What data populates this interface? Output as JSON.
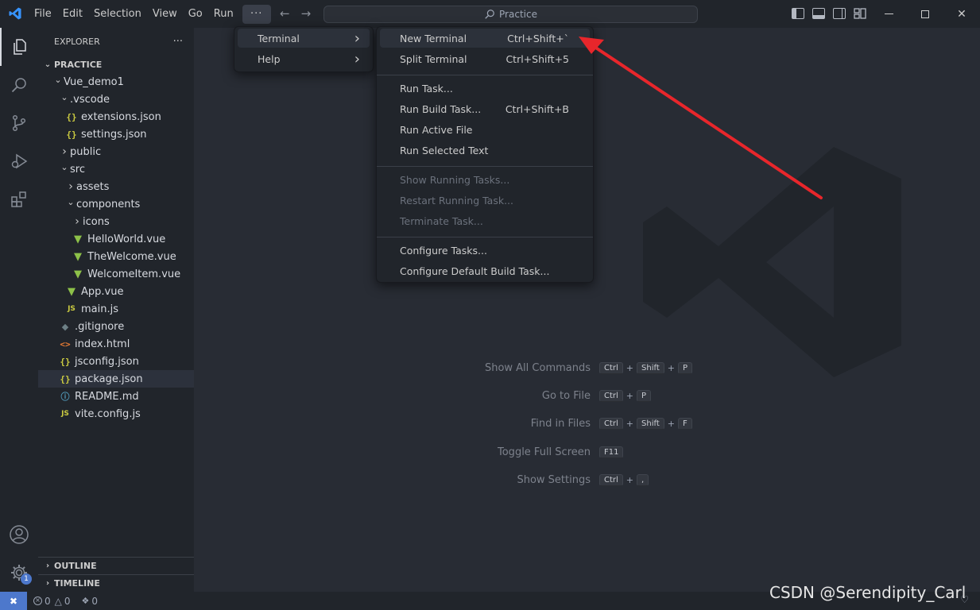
{
  "titlebar": {
    "menus": [
      "File",
      "Edit",
      "Selection",
      "View",
      "Go",
      "Run"
    ],
    "more_label": "···",
    "command_center": "Practice",
    "nav_back_icon": "arrow-left-icon",
    "nav_forward_icon": "arrow-right-icon",
    "layout_icons": [
      "toggle-primary-sidebar-icon",
      "toggle-panel-icon",
      "toggle-secondary-sidebar-icon",
      "customize-layout-icon"
    ],
    "window_controls": [
      "minimize-icon",
      "maximize-icon",
      "close-icon"
    ]
  },
  "activitybar": {
    "items": [
      "explorer-icon",
      "search-icon",
      "source-control-icon",
      "run-debug-icon",
      "extensions-icon"
    ],
    "bottom": [
      "accounts-icon",
      "manage-gear-icon"
    ],
    "manage_badge": "1"
  },
  "sidebar": {
    "title": "EXPLORER",
    "more": "···",
    "section": "PRACTICE",
    "tree": [
      {
        "label": "Vue_demo1",
        "type": "folder-open"
      },
      {
        "label": ".vscode",
        "type": "folder-open"
      },
      {
        "label": "extensions.json",
        "type": "json"
      },
      {
        "label": "settings.json",
        "type": "json"
      },
      {
        "label": "public",
        "type": "folder-closed"
      },
      {
        "label": "src",
        "type": "folder-open"
      },
      {
        "label": "assets",
        "type": "folder-closed"
      },
      {
        "label": "components",
        "type": "folder-open"
      },
      {
        "label": "icons",
        "type": "folder-closed"
      },
      {
        "label": "HelloWorld.vue",
        "type": "vue"
      },
      {
        "label": "TheWelcome.vue",
        "type": "vue"
      },
      {
        "label": "WelcomeItem.vue",
        "type": "vue"
      },
      {
        "label": "App.vue",
        "type": "vue"
      },
      {
        "label": "main.js",
        "type": "js"
      },
      {
        "label": ".gitignore",
        "type": "git"
      },
      {
        "label": "index.html",
        "type": "html"
      },
      {
        "label": "jsconfig.json",
        "type": "json"
      },
      {
        "label": "package.json",
        "type": "json",
        "selected": true
      },
      {
        "label": "README.md",
        "type": "info"
      },
      {
        "label": "vite.config.js",
        "type": "js"
      }
    ],
    "outline": "OUTLINE",
    "timeline": "TIMELINE"
  },
  "menu_level1": {
    "items": [
      {
        "label": "Terminal",
        "highlighted": true
      },
      {
        "label": "Help"
      }
    ]
  },
  "terminal_menu": {
    "groups": [
      [
        {
          "label": "New Terminal",
          "shortcut": "Ctrl+Shift+`",
          "highlighted": true
        },
        {
          "label": "Split Terminal",
          "shortcut": "Ctrl+Shift+5"
        }
      ],
      [
        {
          "label": "Run Task...",
          "shortcut": ""
        },
        {
          "label": "Run Build Task...",
          "shortcut": "Ctrl+Shift+B"
        },
        {
          "label": "Run Active File",
          "shortcut": ""
        },
        {
          "label": "Run Selected Text",
          "shortcut": ""
        }
      ],
      [
        {
          "label": "Show Running Tasks...",
          "shortcut": "",
          "disabled": true
        },
        {
          "label": "Restart Running Task...",
          "shortcut": "",
          "disabled": true
        },
        {
          "label": "Terminate Task...",
          "shortcut": "",
          "disabled": true
        }
      ],
      [
        {
          "label": "Configure Tasks...",
          "shortcut": ""
        },
        {
          "label": "Configure Default Build Task...",
          "shortcut": ""
        }
      ]
    ]
  },
  "welcome_shortcuts": [
    {
      "label": "Show All Commands",
      "keys": [
        "Ctrl",
        "Shift",
        "P"
      ]
    },
    {
      "label": "Go to File",
      "keys": [
        "Ctrl",
        "P"
      ]
    },
    {
      "label": "Find in Files",
      "keys": [
        "Ctrl",
        "Shift",
        "F"
      ]
    },
    {
      "label": "Toggle Full Screen",
      "keys": [
        "F11"
      ]
    },
    {
      "label": "Show Settings",
      "keys": [
        "Ctrl",
        ","
      ]
    }
  ],
  "statusbar": {
    "errors": "0",
    "warnings": "0",
    "ports": "0"
  },
  "watermark": "CSDN @Serendipity_Carl",
  "colors": {
    "accent": "#4d78cc",
    "annotation_arrow": "#e8262b",
    "vue_green": "#8dc149",
    "json_yellow": "#cbcb41"
  }
}
